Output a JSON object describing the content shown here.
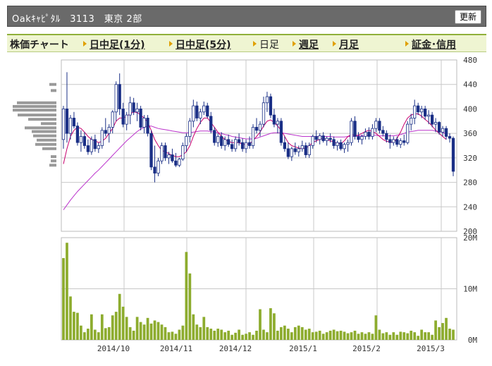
{
  "header": {
    "title": "Oakｷｬﾋﾟﾀﾙ　3113　東京 2部",
    "refresh_label": "更新"
  },
  "tabs": [
    {
      "label": "株価チャート",
      "link": false,
      "arrow": false
    },
    {
      "label": "日中足(1分)",
      "link": true,
      "arrow": true
    },
    {
      "label": "日中足(5分)",
      "link": true,
      "arrow": true
    },
    {
      "label": "日足",
      "link": false,
      "arrow": true
    },
    {
      "label": "週足",
      "link": true,
      "arrow": true
    },
    {
      "label": "月足",
      "link": true,
      "arrow": true
    },
    {
      "label": "証金･信用",
      "link": true,
      "arrow": true
    }
  ],
  "colors": {
    "candle_up": "#ffffff",
    "candle_down": "#1a2f86",
    "candle_outline": "#1a2f86",
    "ma_short": "#c8006e",
    "ma_long": "#bb33cc",
    "volume_bar": "#8dac2e",
    "volume_profile": "#999999",
    "grid": "#c8c8c8"
  },
  "chart_data": {
    "type": "candlestick",
    "price_axis": {
      "ticks": [
        "480",
        "440",
        "400",
        "360",
        "320",
        "280",
        "240",
        "200"
      ],
      "ylim": [
        200,
        480
      ],
      "position": "right"
    },
    "volume_axis": {
      "ticks": [
        "20M",
        "10M",
        "0M"
      ],
      "ylim": [
        0,
        20000000
      ],
      "position": "right"
    },
    "x_tick_labels": [
      "2014/10",
      "2014/11",
      "2014/12",
      "2015/1",
      "2015/2",
      "2015/3"
    ],
    "grid": true,
    "candles": [
      {
        "o": 350,
        "h": 405,
        "l": 335,
        "c": 400
      },
      {
        "o": 400,
        "h": 460,
        "l": 345,
        "c": 360
      },
      {
        "o": 360,
        "h": 390,
        "l": 350,
        "c": 385
      },
      {
        "o": 385,
        "h": 395,
        "l": 368,
        "c": 372
      },
      {
        "o": 372,
        "h": 378,
        "l": 340,
        "c": 345
      },
      {
        "o": 345,
        "h": 365,
        "l": 330,
        "c": 355
      },
      {
        "o": 355,
        "h": 362,
        "l": 335,
        "c": 340
      },
      {
        "o": 340,
        "h": 350,
        "l": 325,
        "c": 330
      },
      {
        "o": 330,
        "h": 355,
        "l": 325,
        "c": 350
      },
      {
        "o": 350,
        "h": 358,
        "l": 330,
        "c": 335
      },
      {
        "o": 335,
        "h": 345,
        "l": 328,
        "c": 340
      },
      {
        "o": 340,
        "h": 370,
        "l": 335,
        "c": 365
      },
      {
        "o": 365,
        "h": 385,
        "l": 355,
        "c": 360
      },
      {
        "o": 360,
        "h": 375,
        "l": 345,
        "c": 370
      },
      {
        "o": 370,
        "h": 398,
        "l": 360,
        "c": 395
      },
      {
        "o": 395,
        "h": 445,
        "l": 380,
        "c": 440
      },
      {
        "o": 440,
        "h": 458,
        "l": 390,
        "c": 400
      },
      {
        "o": 400,
        "h": 410,
        "l": 370,
        "c": 375
      },
      {
        "o": 375,
        "h": 395,
        "l": 365,
        "c": 390
      },
      {
        "o": 390,
        "h": 420,
        "l": 375,
        "c": 410
      },
      {
        "o": 410,
        "h": 418,
        "l": 390,
        "c": 395
      },
      {
        "o": 395,
        "h": 410,
        "l": 380,
        "c": 400
      },
      {
        "o": 400,
        "h": 405,
        "l": 365,
        "c": 370
      },
      {
        "o": 370,
        "h": 390,
        "l": 360,
        "c": 385
      },
      {
        "o": 385,
        "h": 390,
        "l": 355,
        "c": 360
      },
      {
        "o": 360,
        "h": 365,
        "l": 300,
        "c": 305
      },
      {
        "o": 305,
        "h": 340,
        "l": 280,
        "c": 295
      },
      {
        "o": 295,
        "h": 320,
        "l": 290,
        "c": 315
      },
      {
        "o": 315,
        "h": 345,
        "l": 310,
        "c": 340
      },
      {
        "o": 340,
        "h": 345,
        "l": 315,
        "c": 320
      },
      {
        "o": 320,
        "h": 330,
        "l": 310,
        "c": 325
      },
      {
        "o": 325,
        "h": 335,
        "l": 312,
        "c": 315
      },
      {
        "o": 315,
        "h": 328,
        "l": 305,
        "c": 308
      },
      {
        "o": 308,
        "h": 320,
        "l": 305,
        "c": 318
      },
      {
        "o": 318,
        "h": 345,
        "l": 315,
        "c": 340
      },
      {
        "o": 340,
        "h": 360,
        "l": 330,
        "c": 355
      },
      {
        "o": 355,
        "h": 385,
        "l": 345,
        "c": 380
      },
      {
        "o": 380,
        "h": 415,
        "l": 370,
        "c": 405
      },
      {
        "o": 405,
        "h": 412,
        "l": 380,
        "c": 385
      },
      {
        "o": 385,
        "h": 400,
        "l": 375,
        "c": 395
      },
      {
        "o": 395,
        "h": 412,
        "l": 390,
        "c": 405
      },
      {
        "o": 405,
        "h": 410,
        "l": 385,
        "c": 388
      },
      {
        "o": 388,
        "h": 395,
        "l": 360,
        "c": 365
      },
      {
        "o": 365,
        "h": 370,
        "l": 340,
        "c": 345
      },
      {
        "o": 345,
        "h": 360,
        "l": 338,
        "c": 355
      },
      {
        "o": 355,
        "h": 362,
        "l": 335,
        "c": 340
      },
      {
        "o": 340,
        "h": 355,
        "l": 332,
        "c": 350
      },
      {
        "o": 350,
        "h": 358,
        "l": 338,
        "c": 342
      },
      {
        "o": 342,
        "h": 350,
        "l": 330,
        "c": 335
      },
      {
        "o": 335,
        "h": 355,
        "l": 330,
        "c": 350
      },
      {
        "o": 350,
        "h": 360,
        "l": 340,
        "c": 345
      },
      {
        "o": 345,
        "h": 352,
        "l": 330,
        "c": 335
      },
      {
        "o": 335,
        "h": 350,
        "l": 328,
        "c": 345
      },
      {
        "o": 345,
        "h": 355,
        "l": 335,
        "c": 340
      },
      {
        "o": 340,
        "h": 375,
        "l": 335,
        "c": 370
      },
      {
        "o": 370,
        "h": 385,
        "l": 360,
        "c": 365
      },
      {
        "o": 365,
        "h": 380,
        "l": 355,
        "c": 375
      },
      {
        "o": 375,
        "h": 420,
        "l": 370,
        "c": 410
      },
      {
        "o": 410,
        "h": 428,
        "l": 395,
        "c": 420
      },
      {
        "o": 420,
        "h": 425,
        "l": 385,
        "c": 390
      },
      {
        "o": 390,
        "h": 400,
        "l": 370,
        "c": 375
      },
      {
        "o": 375,
        "h": 385,
        "l": 360,
        "c": 380
      },
      {
        "o": 380,
        "h": 385,
        "l": 340,
        "c": 345
      },
      {
        "o": 345,
        "h": 355,
        "l": 330,
        "c": 335
      },
      {
        "o": 335,
        "h": 345,
        "l": 318,
        "c": 322
      },
      {
        "o": 322,
        "h": 338,
        "l": 315,
        "c": 335
      },
      {
        "o": 335,
        "h": 345,
        "l": 325,
        "c": 330
      },
      {
        "o": 330,
        "h": 340,
        "l": 322,
        "c": 335
      },
      {
        "o": 335,
        "h": 348,
        "l": 330,
        "c": 340
      },
      {
        "o": 340,
        "h": 345,
        "l": 320,
        "c": 325
      },
      {
        "o": 325,
        "h": 345,
        "l": 320,
        "c": 340
      },
      {
        "o": 340,
        "h": 358,
        "l": 335,
        "c": 355
      },
      {
        "o": 355,
        "h": 365,
        "l": 345,
        "c": 350
      },
      {
        "o": 350,
        "h": 360,
        "l": 342,
        "c": 356
      },
      {
        "o": 356,
        "h": 362,
        "l": 345,
        "c": 348
      },
      {
        "o": 348,
        "h": 355,
        "l": 340,
        "c": 352
      },
      {
        "o": 352,
        "h": 360,
        "l": 345,
        "c": 350
      },
      {
        "o": 350,
        "h": 355,
        "l": 335,
        "c": 340
      },
      {
        "o": 340,
        "h": 348,
        "l": 332,
        "c": 345
      },
      {
        "o": 345,
        "h": 350,
        "l": 332,
        "c": 335
      },
      {
        "o": 335,
        "h": 345,
        "l": 328,
        "c": 342
      },
      {
        "o": 342,
        "h": 350,
        "l": 330,
        "c": 345
      },
      {
        "o": 345,
        "h": 385,
        "l": 340,
        "c": 380
      },
      {
        "o": 380,
        "h": 388,
        "l": 350,
        "c": 355
      },
      {
        "o": 355,
        "h": 362,
        "l": 345,
        "c": 350
      },
      {
        "o": 350,
        "h": 358,
        "l": 342,
        "c": 355
      },
      {
        "o": 355,
        "h": 368,
        "l": 350,
        "c": 362
      },
      {
        "o": 362,
        "h": 370,
        "l": 350,
        "c": 355
      },
      {
        "o": 355,
        "h": 375,
        "l": 350,
        "c": 368
      },
      {
        "o": 368,
        "h": 385,
        "l": 362,
        "c": 380
      },
      {
        "o": 380,
        "h": 385,
        "l": 360,
        "c": 365
      },
      {
        "o": 365,
        "h": 372,
        "l": 355,
        "c": 360
      },
      {
        "o": 360,
        "h": 365,
        "l": 345,
        "c": 350
      },
      {
        "o": 350,
        "h": 358,
        "l": 335,
        "c": 345
      },
      {
        "o": 345,
        "h": 355,
        "l": 340,
        "c": 350
      },
      {
        "o": 350,
        "h": 355,
        "l": 338,
        "c": 342
      },
      {
        "o": 342,
        "h": 352,
        "l": 336,
        "c": 348
      },
      {
        "o": 348,
        "h": 358,
        "l": 340,
        "c": 345
      },
      {
        "o": 345,
        "h": 380,
        "l": 342,
        "c": 375
      },
      {
        "o": 375,
        "h": 392,
        "l": 365,
        "c": 385
      },
      {
        "o": 385,
        "h": 415,
        "l": 375,
        "c": 405
      },
      {
        "o": 405,
        "h": 410,
        "l": 390,
        "c": 395
      },
      {
        "o": 395,
        "h": 405,
        "l": 385,
        "c": 400
      },
      {
        "o": 400,
        "h": 405,
        "l": 382,
        "c": 388
      },
      {
        "o": 388,
        "h": 398,
        "l": 375,
        "c": 390
      },
      {
        "o": 390,
        "h": 395,
        "l": 370,
        "c": 375
      },
      {
        "o": 375,
        "h": 385,
        "l": 362,
        "c": 378
      },
      {
        "o": 378,
        "h": 380,
        "l": 358,
        "c": 362
      },
      {
        "o": 362,
        "h": 372,
        "l": 355,
        "c": 368
      },
      {
        "o": 368,
        "h": 372,
        "l": 350,
        "c": 355
      },
      {
        "o": 355,
        "h": 360,
        "l": 345,
        "c": 352
      },
      {
        "o": 352,
        "h": 355,
        "l": 290,
        "c": 298
      }
    ],
    "ma_short": [
      310,
      335,
      355,
      365,
      370,
      368,
      362,
      355,
      350,
      348,
      345,
      347,
      352,
      360,
      368,
      380,
      385,
      385,
      388,
      392,
      395,
      394,
      390,
      385,
      378,
      365,
      350,
      340,
      332,
      330,
      327,
      324,
      322,
      322,
      325,
      330,
      340,
      355,
      368,
      378,
      385,
      385,
      378,
      370,
      362,
      355,
      350,
      347,
      345,
      345,
      345,
      342,
      342,
      343,
      348,
      355,
      362,
      372,
      380,
      382,
      378,
      372,
      365,
      355,
      345,
      340,
      338,
      336,
      335,
      336,
      340,
      345,
      348,
      350,
      352,
      350,
      348,
      346,
      344,
      343,
      348,
      355,
      358,
      357,
      357,
      360,
      363,
      365,
      363,
      360,
      355,
      350,
      347,
      346,
      345,
      352,
      362,
      375,
      385,
      390,
      392,
      392,
      388,
      383,
      378,
      372,
      365,
      360,
      355,
      350
    ],
    "ma_long": [
      235,
      243,
      251,
      258,
      265,
      271,
      277,
      283,
      289,
      295,
      300,
      306,
      312,
      318,
      324,
      330,
      336,
      342,
      348,
      353,
      358,
      363,
      367,
      370,
      372,
      372,
      370,
      368,
      367,
      366,
      365,
      364,
      363,
      362,
      361,
      361,
      361,
      362,
      363,
      364,
      364,
      364,
      363,
      362,
      361,
      360,
      358,
      357,
      355,
      354,
      353,
      352,
      351,
      351,
      351,
      352,
      354,
      356,
      358,
      360,
      361,
      361,
      361,
      360,
      359,
      358,
      357,
      356,
      355,
      355,
      355,
      355,
      355,
      355,
      355,
      355,
      355,
      354,
      354,
      354,
      354,
      355,
      355,
      355,
      356,
      356,
      356,
      357,
      357,
      357,
      356,
      356,
      356,
      356,
      356,
      357,
      358,
      360,
      362,
      363,
      364,
      365,
      365,
      365,
      365,
      365,
      364,
      363,
      362,
      358
    ],
    "volumes": [
      16,
      19,
      8.5,
      5.5,
      5.3,
      2.8,
      1.5,
      2.2,
      5,
      2,
      1.5,
      5,
      2.3,
      2.5,
      4.8,
      5.5,
      9,
      6.5,
      4.5,
      2.5,
      1.8,
      4.5,
      3.5,
      3,
      4.3,
      3.2,
      3.8,
      3.5,
      3,
      2.5,
      1.5,
      1.6,
      1.2,
      2,
      2.8,
      17.2,
      13,
      5,
      3,
      2.5,
      4.5,
      2.5,
      2.2,
      1.8,
      2.2,
      2,
      1.5,
      1.8,
      1,
      1.4,
      2,
      1,
      1.2,
      1.5,
      1,
      1.8,
      6,
      2,
      1.5,
      6.2,
      5.2,
      1.8,
      2.5,
      2.8,
      2.2,
      1.5,
      2.5,
      2.8,
      2.5,
      2,
      2.2,
      1.5,
      1.6,
      1.8,
      1.2,
      1.5,
      1.8,
      2,
      1.7,
      1.8,
      1.6,
      1.3,
      1.5,
      1.8,
      1.2,
      1.5,
      1.2,
      1.5,
      1.2,
      4.8,
      2,
      1.3,
      1.5,
      1,
      1.5,
      1,
      1.6,
      1.5,
      1.3,
      1.8,
      1.5,
      0.8,
      2,
      1.5,
      1.5,
      1,
      3.8,
      2.5,
      3.3,
      4.3,
      2.2,
      2,
      2,
      1.8,
      1.6,
      1.5,
      1.3,
      2.2,
      1.3,
      6.2
    ],
    "volume_profile": [
      {
        "price": 440,
        "len": 10
      },
      {
        "price": 430,
        "len": 8
      },
      {
        "price": 410,
        "len": 56
      },
      {
        "price": 404,
        "len": 62
      },
      {
        "price": 398,
        "len": 62
      },
      {
        "price": 390,
        "len": 55
      },
      {
        "price": 383,
        "len": 40
      },
      {
        "price": 376,
        "len": 22
      },
      {
        "price": 369,
        "len": 45
      },
      {
        "price": 363,
        "len": 35
      },
      {
        "price": 356,
        "len": 33
      },
      {
        "price": 349,
        "len": 28
      },
      {
        "price": 342,
        "len": 30
      },
      {
        "price": 335,
        "len": 20
      },
      {
        "price": 322,
        "len": 8
      },
      {
        "price": 315,
        "len": 8
      },
      {
        "price": 308,
        "len": 10
      }
    ]
  }
}
